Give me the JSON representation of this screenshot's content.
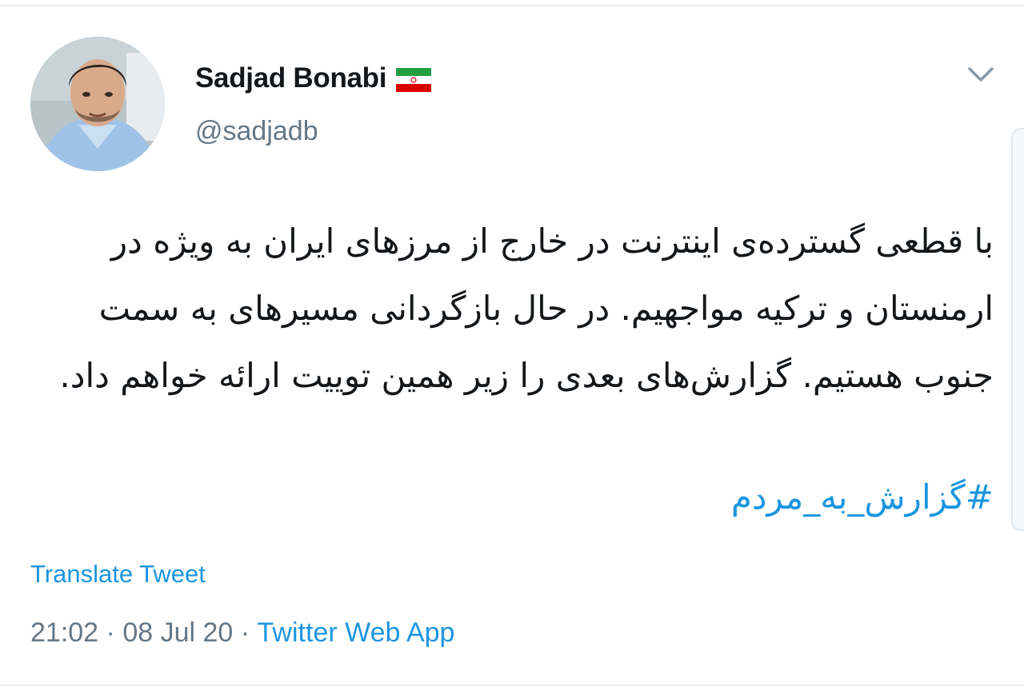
{
  "tweet": {
    "author": {
      "display_name": "Sadjad Bonabi",
      "handle": "@sadjadb",
      "flag_icon": "iran-flag-icon"
    },
    "text": "با قطعی گسترده‌ی اینترنت در خارج از مرزهای ایران به ویژه در ارمنستان و ترکیه مواجهیم. در حال بازگردانی مسیرهای به سمت جنوب هستیم. گزارش‌های بعدی را زیر همین توییت ارائه خواهم داد.",
    "hashtag": "#گزارش_به_مردم",
    "translate_label": "Translate Tweet",
    "time": "21:02",
    "separator": " · ",
    "date": "08 Jul 20",
    "source": "Twitter Web App"
  },
  "colors": {
    "link": "#1b95e0",
    "secondary_text": "#657786",
    "primary_text": "#14171a"
  },
  "icons": {
    "menu": "chevron-down-icon"
  }
}
